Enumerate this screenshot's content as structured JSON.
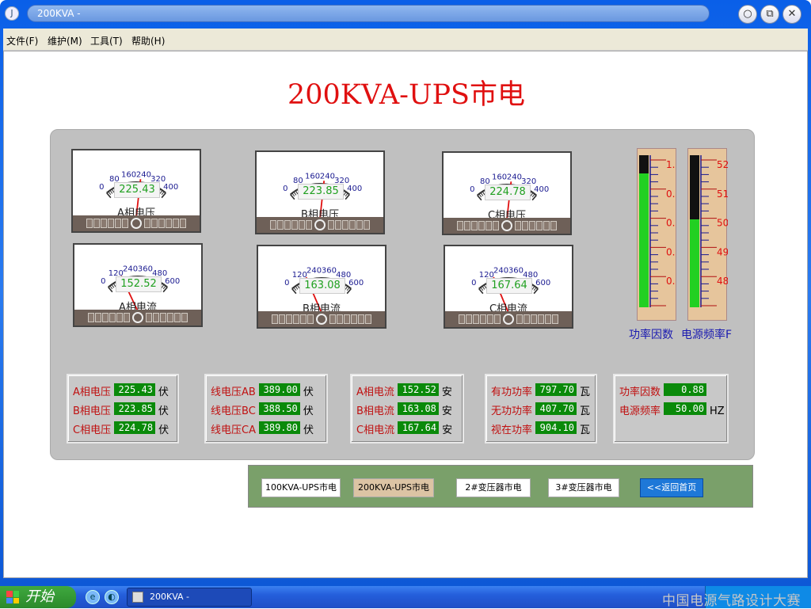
{
  "window": {
    "title": "200KVA -",
    "controls": {
      "minimize": "○",
      "restore": "⧉",
      "close": "✕"
    }
  },
  "menu": [
    {
      "label": "文件(F)"
    },
    {
      "label": "维护(M)"
    },
    {
      "label": "工具(T)"
    },
    {
      "label": "帮助(H)"
    }
  ],
  "page": {
    "title": "200KVA-UPS市电"
  },
  "meters": {
    "voltage_scale": [
      "0",
      "80",
      "160",
      "240",
      "320",
      "400"
    ],
    "current_scale": [
      "0",
      "120",
      "240",
      "360",
      "480",
      "600"
    ],
    "voltage": [
      {
        "label": "A相电压",
        "value": "225.43",
        "needle_fraction": 0.563
      },
      {
        "label": "B相电压",
        "value": "223.85",
        "needle_fraction": 0.56
      },
      {
        "label": "C相电压",
        "value": "224.78",
        "needle_fraction": 0.562
      }
    ],
    "current": [
      {
        "label": "A相电流",
        "value": "152.52",
        "needle_fraction": 0.254
      },
      {
        "label": "B相电流",
        "value": "163.08",
        "needle_fraction": 0.272
      },
      {
        "label": "C相电流",
        "value": "167.64",
        "needle_fraction": 0.279
      }
    ]
  },
  "gauges": [
    {
      "name": "功率因数",
      "level": 0.88,
      "ticks": [
        "1.",
        "0.",
        "0.",
        "0.",
        "0."
      ]
    },
    {
      "name": "电源频率F",
      "level": 0.58,
      "ticks": [
        "52",
        "51",
        "50",
        "49",
        "48"
      ]
    }
  ],
  "readouts": [
    {
      "rows": [
        {
          "label": "A相电压",
          "value": "225.43",
          "unit": "伏"
        },
        {
          "label": "B相电压",
          "value": "223.85",
          "unit": "伏"
        },
        {
          "label": "C相电压",
          "value": "224.78",
          "unit": "伏"
        }
      ]
    },
    {
      "rows": [
        {
          "label": "线电压AB",
          "value": "389.00",
          "unit": "伏"
        },
        {
          "label": "线电压BC",
          "value": "388.50",
          "unit": "伏"
        },
        {
          "label": "线电压CA",
          "value": "389.80",
          "unit": "伏"
        }
      ]
    },
    {
      "rows": [
        {
          "label": "A相电流",
          "value": "152.52",
          "unit": "安"
        },
        {
          "label": "B相电流",
          "value": "163.08",
          "unit": "安"
        },
        {
          "label": "C相电流",
          "value": "167.64",
          "unit": "安"
        }
      ]
    },
    {
      "rows": [
        {
          "label": "有功功率",
          "value": "797.70",
          "unit": "瓦"
        },
        {
          "label": "无功功率",
          "value": "407.70",
          "unit": "瓦"
        },
        {
          "label": "视在功率",
          "value": "904.10",
          "unit": "瓦"
        }
      ]
    },
    {
      "rows": [
        {
          "label": "功率因数",
          "value": "0.88",
          "unit": ""
        },
        {
          "label": "电源频率",
          "value": "50.00",
          "unit": "HZ"
        }
      ]
    }
  ],
  "nav": {
    "buttons": [
      {
        "label": "100KVA-UPS市电",
        "active": false
      },
      {
        "label": "200KVA-UPS市电",
        "active": true
      },
      {
        "label": "2#变压器市电",
        "active": false
      },
      {
        "label": "3#变压器市电",
        "active": false
      }
    ],
    "home": "<<返回首页"
  },
  "taskbar": {
    "start": "开始",
    "task_item": "200KVA -",
    "quicklaunch": [
      "ie-icon",
      "media-icon"
    ]
  },
  "watermark": "中国电源气路设计大赛",
  "colors": {
    "accent_red": "#e01010",
    "readout_green": "#0a8a0a",
    "needle": "#e01010",
    "gauge_fill": "#22d022",
    "nav_bg": "#7aa06a",
    "home_button": "#1e78d8"
  }
}
